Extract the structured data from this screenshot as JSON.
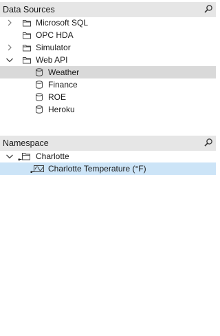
{
  "data_sources": {
    "title": "Data Sources",
    "items": [
      {
        "label": "Microsoft SQL",
        "icon": "folder-icon",
        "expander": "chevron-right-icon"
      },
      {
        "label": "OPC HDA",
        "icon": "folder-icon",
        "expander": "none"
      },
      {
        "label": "Simulator",
        "icon": "folder-icon",
        "expander": "chevron-right-icon"
      },
      {
        "label": "Web API",
        "icon": "folder-icon",
        "expander": "chevron-down-icon"
      }
    ],
    "children": [
      {
        "label": "Weather",
        "icon": "database-icon",
        "selected": true
      },
      {
        "label": "Finance",
        "icon": "database-icon"
      },
      {
        "label": "ROE",
        "icon": "database-icon"
      },
      {
        "label": "Heroku",
        "icon": "database-icon"
      }
    ]
  },
  "namespace": {
    "title": "Namespace",
    "root": {
      "label": "Charlotte",
      "icon": "folder-icon",
      "expander": "chevron-down-icon"
    },
    "child": {
      "label": "Charlotte Temperature (°F)",
      "icon": "signal-icon",
      "selected": true
    }
  },
  "colors": {
    "header_bg": "#e6e6e6",
    "selected_gray": "#d9d9d9",
    "selected_blue": "#cce4f7"
  }
}
